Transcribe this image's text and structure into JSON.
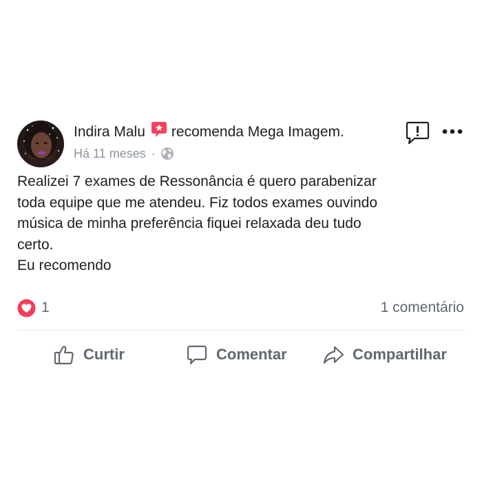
{
  "post": {
    "author": "Indira Malu",
    "action_text": "recomenda Mega Imagem.",
    "timestamp": "Há 11 meses",
    "separator": "·",
    "privacy_icon": "globe-icon",
    "recommend_icon": "recommend-star-icon",
    "body_lines": [
      "Realizei 7 exames de Ressonância é quero parabenizar",
      "toda equipe que me atendeu. Fiz todos exames ouvindo",
      "música de minha preferência fiquei relaxada deu tudo",
      "certo.",
      "Eu recomendo"
    ]
  },
  "reactions": {
    "icon": "love-reaction-icon",
    "count": "1",
    "comments": "1 comentário"
  },
  "actions": {
    "like": "Curtir",
    "comment": "Comentar",
    "share": "Compartilhar"
  },
  "colors": {
    "text": "#1c1e21",
    "secondary": "#606770",
    "meta": "#8d949e",
    "recommend_red": "#f3425f",
    "divider": "#e4e6eb"
  }
}
